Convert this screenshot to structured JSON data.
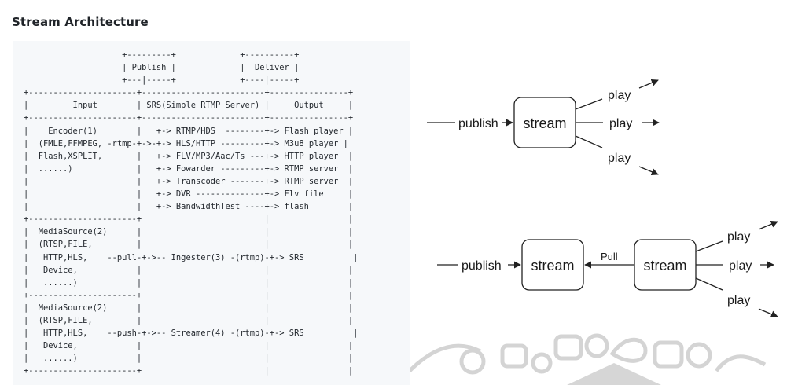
{
  "page": {
    "title": "Stream Architecture"
  },
  "code_block": {
    "text": "                    +---------+             +----------+\n                    | Publish |             |  Deliver |\n                    +---|-----+             +----|-----+\n+----------------------+-------------------------+----------------+\n|         Input        | SRS(Simple RTMP Server) |     Output     |\n+----------------------+-------------------------+----------------+\n|    Encoder(1)        |   +-> RTMP/HDS  --------+-> Flash player |\n|  (FMLE,FFMPEG, -rtmp-+->-+-> HLS/HTTP ---------+-> M3u8 player |\n|  Flash,XSPLIT,       |   +-> FLV/MP3/Aac/Ts ---+-> HTTP player  |\n|  ......)             |   +-> Fowarder ---------+-> RTMP server  |\n|                      |   +-> Transcoder -------+-> RTMP server  |\n|                      |   +-> DVR --------------+-> Flv file     |\n|                      |   +-> BandwidthTest ----+-> flash        |\n+----------------------+                         |                |\n|  MediaSource(2)      |                         |                |\n|  (RTSP,FILE,         |                         |                |\n|   HTTP,HLS,    --pull-+->-- Ingester(3) -(rtmp)-+-> SRS          |\n|   Device,            |                         |                |\n|   ......)            |                         |                |\n+----------------------+                         |                |\n|  MediaSource(2)      |                         |                |\n|  (RTSP,FILE,         |                         |                |\n|   HTTP,HLS,    --push-+->-- Streamer(4) -(rtmp)-+-> SRS          |\n|   Device,            |                         |                |\n|   ......)            |                         |                |\n+----------------------+                         |                |"
  },
  "diagram_top": {
    "publish_label": "publish",
    "stream_label": "stream",
    "play_labels": [
      "play",
      "play",
      "play"
    ]
  },
  "diagram_bottom": {
    "publish_label": "publish",
    "stream_left_label": "stream",
    "pull_label": "Pull",
    "stream_right_label": "stream",
    "play_labels": [
      "play",
      "play",
      "play"
    ]
  },
  "colors": {
    "code_background": "#f6f8fa",
    "line": "#222222",
    "watermark": "#d4d4d4"
  }
}
